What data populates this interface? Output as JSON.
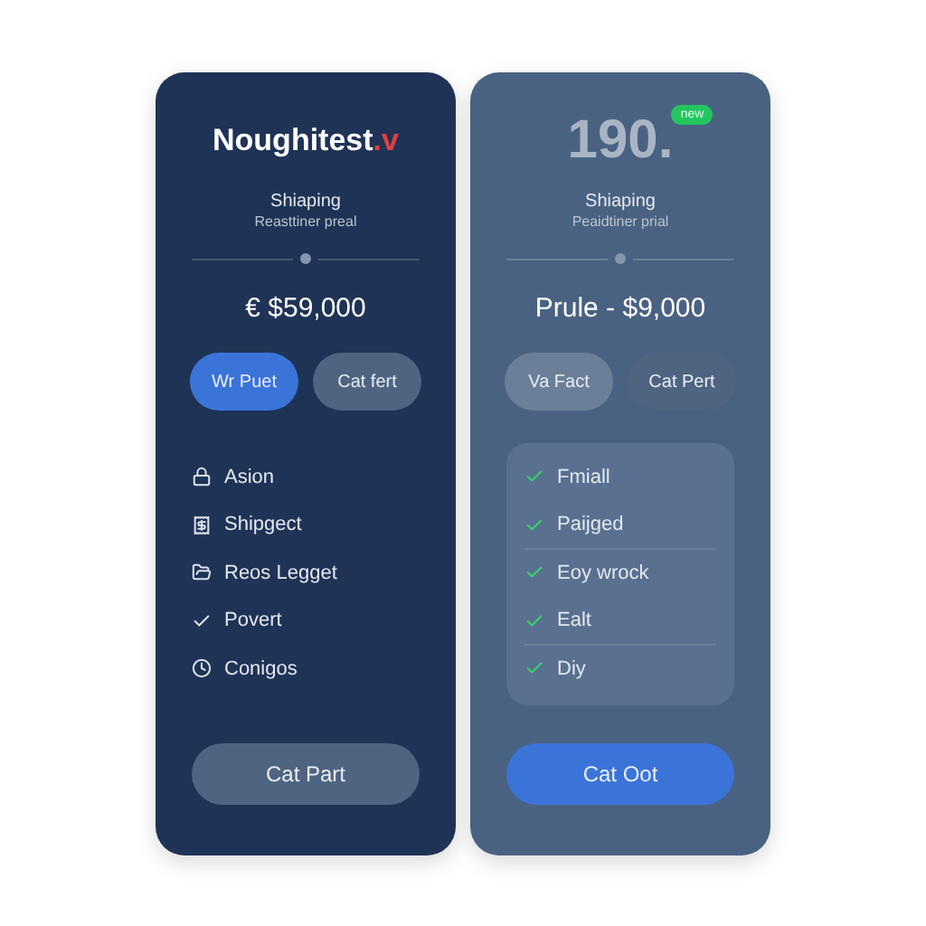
{
  "cards": [
    {
      "kind": "dark",
      "title": "Noughitest",
      "title_accent": ".v",
      "subtitle": "Shiaping",
      "caption": "Reasttiner preal",
      "price": "€ $59,000",
      "buttons": [
        {
          "label": "Wr Puet",
          "kind": "primary"
        },
        {
          "label": "Cat fert",
          "kind": "secondary"
        }
      ],
      "features": [
        {
          "label": "Asion"
        },
        {
          "label": "Shipgect"
        },
        {
          "label": "Reos Legget"
        },
        {
          "label": "Povert"
        },
        {
          "label": "Conigos"
        }
      ],
      "action": {
        "label": "Cat Part",
        "kind": "secondary"
      }
    },
    {
      "kind": "light",
      "title": "190.",
      "badge": "new",
      "subtitle": "Shiaping",
      "caption": "Peaidtiner prial",
      "price": "Prule - $9,000",
      "buttons": [
        {
          "label": "Va Fact",
          "kind": "tinted"
        },
        {
          "label": "Cat Pert",
          "kind": "secondary"
        }
      ],
      "features": [
        {
          "label": "Fmiall",
          "divider": false
        },
        {
          "label": "Paijged",
          "divider": true
        },
        {
          "label": "Eoy wrock",
          "divider": false
        },
        {
          "label": "Ealt",
          "divider": true
        },
        {
          "label": "Diy",
          "divider": false
        }
      ],
      "action": {
        "label": "Cat Oot",
        "kind": "primary"
      }
    }
  ]
}
